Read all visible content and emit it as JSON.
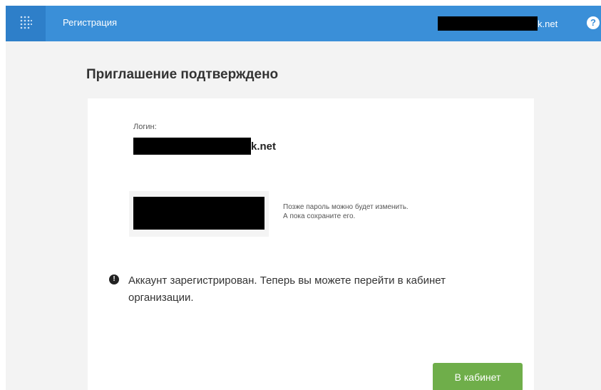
{
  "header": {
    "app_title": "Регистрация",
    "user_email_suffix": "k.net",
    "help_icon": "question-circle-icon",
    "logo_icon": "dot-grid-logo-icon",
    "accent_color": "#3a8fd8"
  },
  "main": {
    "title": "Приглашение подтверждено",
    "login_label": "Логин:",
    "login_value_suffix": "k.net",
    "password_hint_line1": "Позже пароль можно будет изменить.",
    "password_hint_line2": "А пока сохраните его.",
    "notice_icon": "info-icon",
    "notice_text": "Аккаунт зарегистрирован. Теперь вы можете перейти в кабинет организации.",
    "button_label": "В кабинет",
    "button_color": "#6fae4a"
  }
}
